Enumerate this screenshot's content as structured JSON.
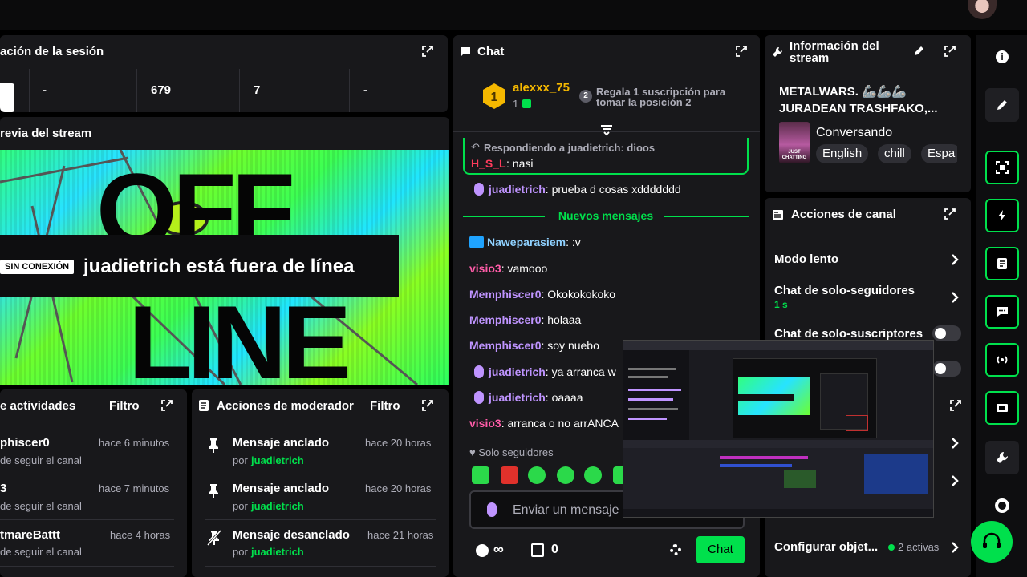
{
  "session": {
    "title": "ación de la sesión",
    "stats": [
      "-",
      "679",
      "7",
      "-"
    ]
  },
  "preview": {
    "title": "revia del stream",
    "offline_badge": "SIN CONEXIÓN",
    "offline_text": "juadietrich está fuera de línea",
    "art_text": "OFF LINE"
  },
  "activity": {
    "title": "e actividades",
    "filter": "Filtro",
    "items": [
      {
        "name": "phiscer0",
        "time": "hace 6 minutos",
        "desc": "de seguir el canal"
      },
      {
        "name": "3",
        "time": "hace 7 minutos",
        "desc": "de seguir el canal"
      },
      {
        "name": "tmareBattt",
        "time": "hace 4 horas",
        "desc": "de seguir el canal"
      }
    ]
  },
  "mod_actions": {
    "title": "Acciones de moderador",
    "filter": "Filtro",
    "items": [
      {
        "action": "Mensaje anclado",
        "by": "por",
        "user": "juadietrich",
        "time": "hace 20 horas"
      },
      {
        "action": "Mensaje anclado",
        "by": "por",
        "user": "juadietrich",
        "time": "hace 20 horas"
      },
      {
        "action": "Mensaje desanclado",
        "by": "por",
        "user": "juadietrich",
        "time": "hace 21 horas"
      }
    ]
  },
  "chat": {
    "title": "Chat",
    "leader": {
      "rank": "1",
      "name": "alexxx_75",
      "count": "1"
    },
    "gift": {
      "rank": "2",
      "text1": "Regala 1 suscripción para",
      "text2": "tomar la posición 2"
    },
    "reply_label": "Respondiendo a juadietrich: dioos",
    "reply_user": "H_S_L",
    "reply_msg": ": nasi",
    "new_messages": "Nuevos mensajes",
    "messages": [
      {
        "user": "juadietrich",
        "text": ": prueba d cosas xddddddd"
      },
      {
        "user": "Naweparasiem",
        "text": ": :v"
      },
      {
        "user": "visio3",
        "text": ": vamooo"
      },
      {
        "user": "Memphiscer0",
        "text": ": Okokokokoko"
      },
      {
        "user": "Memphiscer0",
        "text": ": holaaa"
      },
      {
        "user": "Memphiscer0",
        "text": ": soy nuebo"
      },
      {
        "user": "juadietrich",
        "text": ": ya arranca w"
      },
      {
        "user": "juadietrich",
        "text": ": oaaaa"
      },
      {
        "user": "visio3",
        "text": ": arranca o no arrANCA"
      }
    ],
    "followers_only": "Solo seguidores",
    "input_placeholder": "Enviar un mensaje",
    "points": "∞",
    "gift_count": "0",
    "send_label": "Chat"
  },
  "stream_info": {
    "title1": "Información del",
    "title2": "stream",
    "stream_title1": "METALWARS. 🦾🦾🦾",
    "stream_title2": "JURADEAN TRASHFAKO,...",
    "category": "Conversando",
    "category_art": "JUST CHATTING",
    "tags": [
      "English",
      "chill",
      "Espa"
    ]
  },
  "channel_actions": {
    "title": "Acciones de canal",
    "slow_mode": "Modo lento",
    "followers_chat": "Chat de solo-seguidores",
    "followers_chat_sub": "1 s",
    "subs_chat": "Chat de solo-suscriptores",
    "configure": "Configurar objet...",
    "active": "2 activas"
  },
  "colors": {
    "accent": "#00e04c",
    "user_purple": "#bf94ff",
    "user_green": "#00e04c",
    "user_red": "#ff3b5c"
  }
}
